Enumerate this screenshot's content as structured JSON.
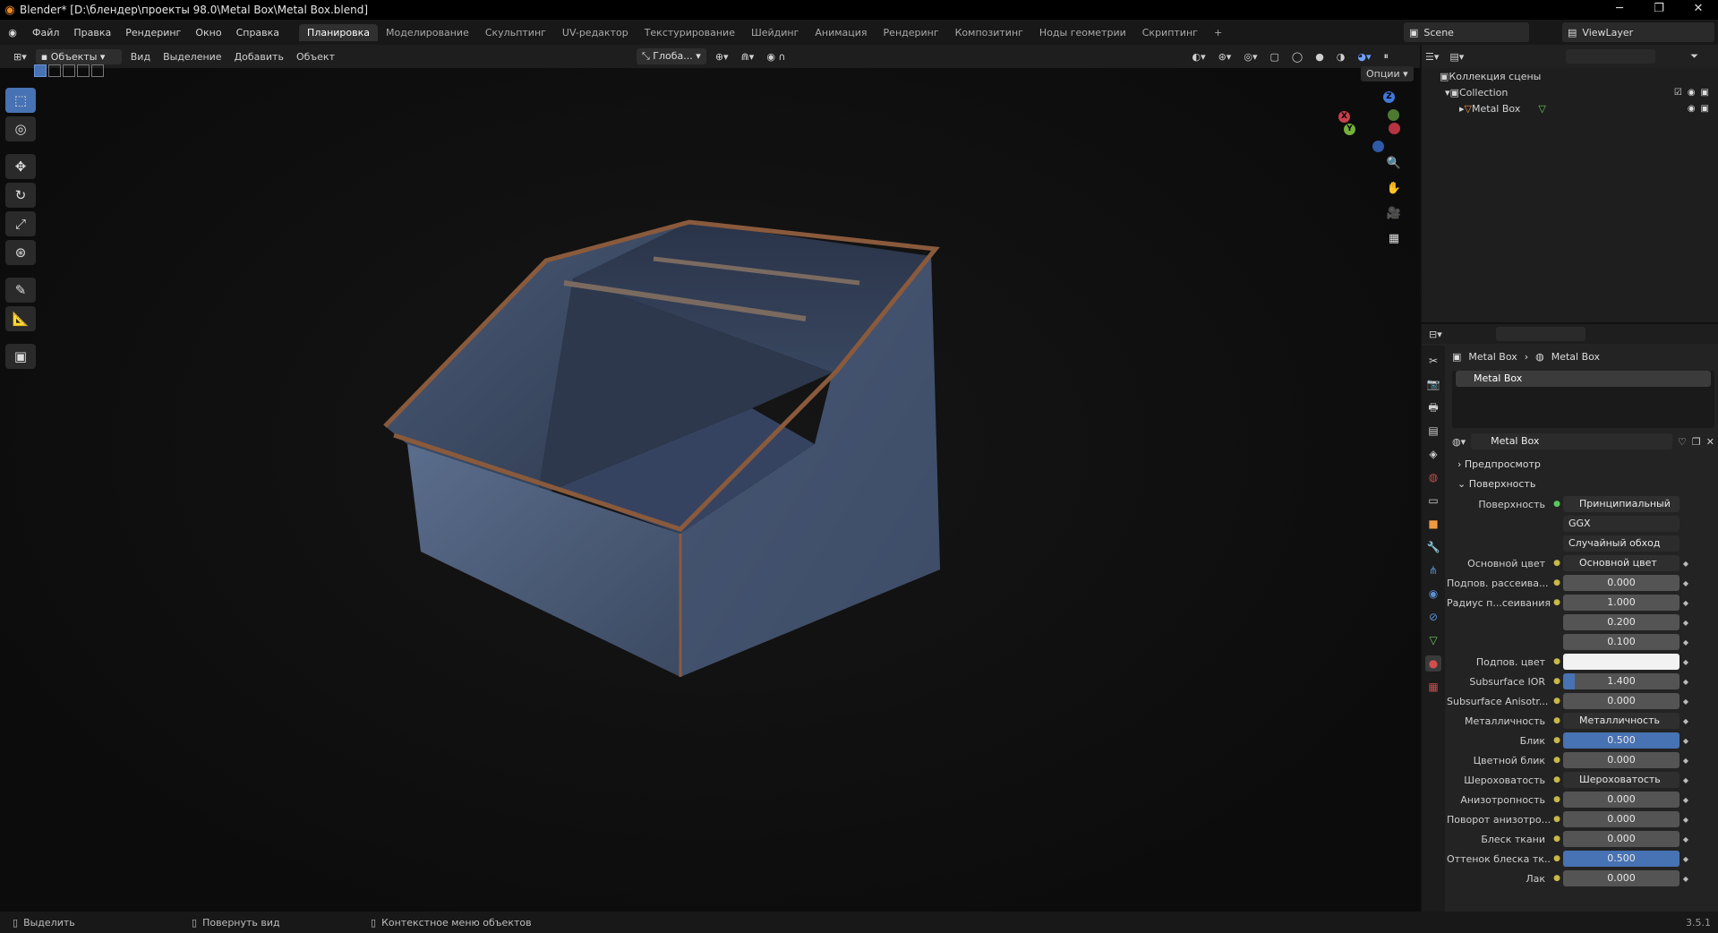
{
  "window": {
    "title": "Blender* [D:\\блендер\\проекты 98.0\\Metal Box\\Metal Box.blend]"
  },
  "menu": [
    "Файл",
    "Правка",
    "Рендеринг",
    "Окно",
    "Справка"
  ],
  "workspaces": [
    "Планировка",
    "Моделирование",
    "Скульптинг",
    "UV-редактор",
    "Текстурирование",
    "Шейдинг",
    "Анимация",
    "Рендеринг",
    "Композитинг",
    "Ноды геометрии",
    "Скриптинг",
    "+"
  ],
  "active_workspace": "Планировка",
  "scene": "Scene",
  "view_layer": "ViewLayer",
  "viewport_header": {
    "mode": "Объекты",
    "menus": [
      "Вид",
      "Выделение",
      "Добавить",
      "Объект"
    ],
    "orientation": "Глоба...",
    "options": "Опции"
  },
  "gizmo": {
    "x": "X",
    "y": "Y",
    "z": "Z"
  },
  "outliner": {
    "scene_collection": "Коллекция сцены",
    "collection": "Collection",
    "object": "Metal Box"
  },
  "properties": {
    "breadcrumb": [
      "Metal Box",
      "Metal Box"
    ],
    "slot": "Metal Box",
    "material": "Metal Box",
    "panels": {
      "preview": "Предпросмотр",
      "surface": "Поверхность"
    },
    "surface_label": "Поверхность",
    "surface_value": "Принципиальный BSDF",
    "distribution": "GGX",
    "subsurface_method": "Случайный обход",
    "rows": [
      {
        "label": "Основной цвет",
        "value": "Основной цвет",
        "kind": "link"
      },
      {
        "label": "Подпов. рассеива...",
        "value": "0.000",
        "kind": "num",
        "fill": 0
      },
      {
        "label": "Радиус п...сеивания",
        "value": "1.000",
        "kind": "num",
        "fill": 0
      },
      {
        "label": "",
        "value": "0.200",
        "kind": "num",
        "fill": 0
      },
      {
        "label": "",
        "value": "0.100",
        "kind": "num",
        "fill": 0
      },
      {
        "label": "Подпов. цвет",
        "value": "",
        "kind": "color"
      },
      {
        "label": "Subsurface IOR",
        "value": "1.400",
        "kind": "num",
        "fill": 0.1
      },
      {
        "label": "Subsurface Anisotr...",
        "value": "0.000",
        "kind": "num",
        "fill": 0
      },
      {
        "label": "Металличность",
        "value": "Металличность",
        "kind": "link"
      },
      {
        "label": "Блик",
        "value": "0.500",
        "kind": "num",
        "fill": 1
      },
      {
        "label": "Цветной блик",
        "value": "0.000",
        "kind": "num",
        "fill": 0
      },
      {
        "label": "Шероховатость",
        "value": "Шероховатость",
        "kind": "link"
      },
      {
        "label": "Анизотропность",
        "value": "0.000",
        "kind": "num",
        "fill": 0
      },
      {
        "label": "Поворот анизотро...",
        "value": "0.000",
        "kind": "num",
        "fill": 0
      },
      {
        "label": "Блеск ткани",
        "value": "0.000",
        "kind": "num",
        "fill": 0
      },
      {
        "label": "Оттенок блеска тк...",
        "value": "0.500",
        "kind": "num",
        "fill": 1
      },
      {
        "label": "Лак",
        "value": "0.000",
        "kind": "num",
        "fill": 0
      }
    ]
  },
  "status": {
    "select": "Выделить",
    "rotate": "Повернуть вид",
    "context": "Контекстное меню объектов",
    "version": "3.5.1"
  }
}
